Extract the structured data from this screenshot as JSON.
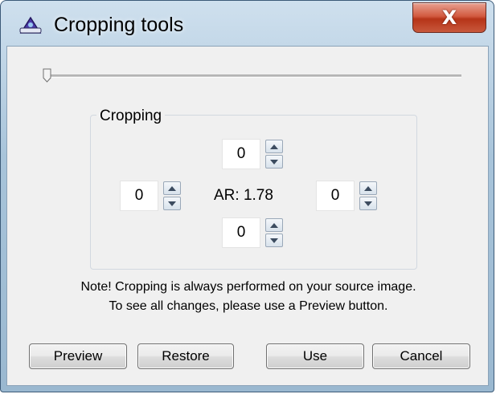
{
  "window": {
    "title": "Cropping tools",
    "close_glyph": "X"
  },
  "slider": {
    "value": 0.0
  },
  "cropping": {
    "group_label": "Cropping",
    "top": "0",
    "left": "0",
    "right": "0",
    "bottom": "0",
    "aspect_ratio_label": "AR: 1.78"
  },
  "note": {
    "line1": "Note! Cropping is always performed on your source image.",
    "line2": "To see all changes, please use a Preview button."
  },
  "buttons": {
    "preview": "Preview",
    "restore": "Restore",
    "use": "Use",
    "cancel": "Cancel"
  },
  "colors": {
    "title_frame": "#a8c4da",
    "close_button": "#c8452a",
    "client_background": "#f0f0f0"
  },
  "icons": {
    "app": "app-logo-icon",
    "close": "close-icon",
    "spin_up": "arrow-up-icon",
    "spin_down": "arrow-down-icon"
  }
}
